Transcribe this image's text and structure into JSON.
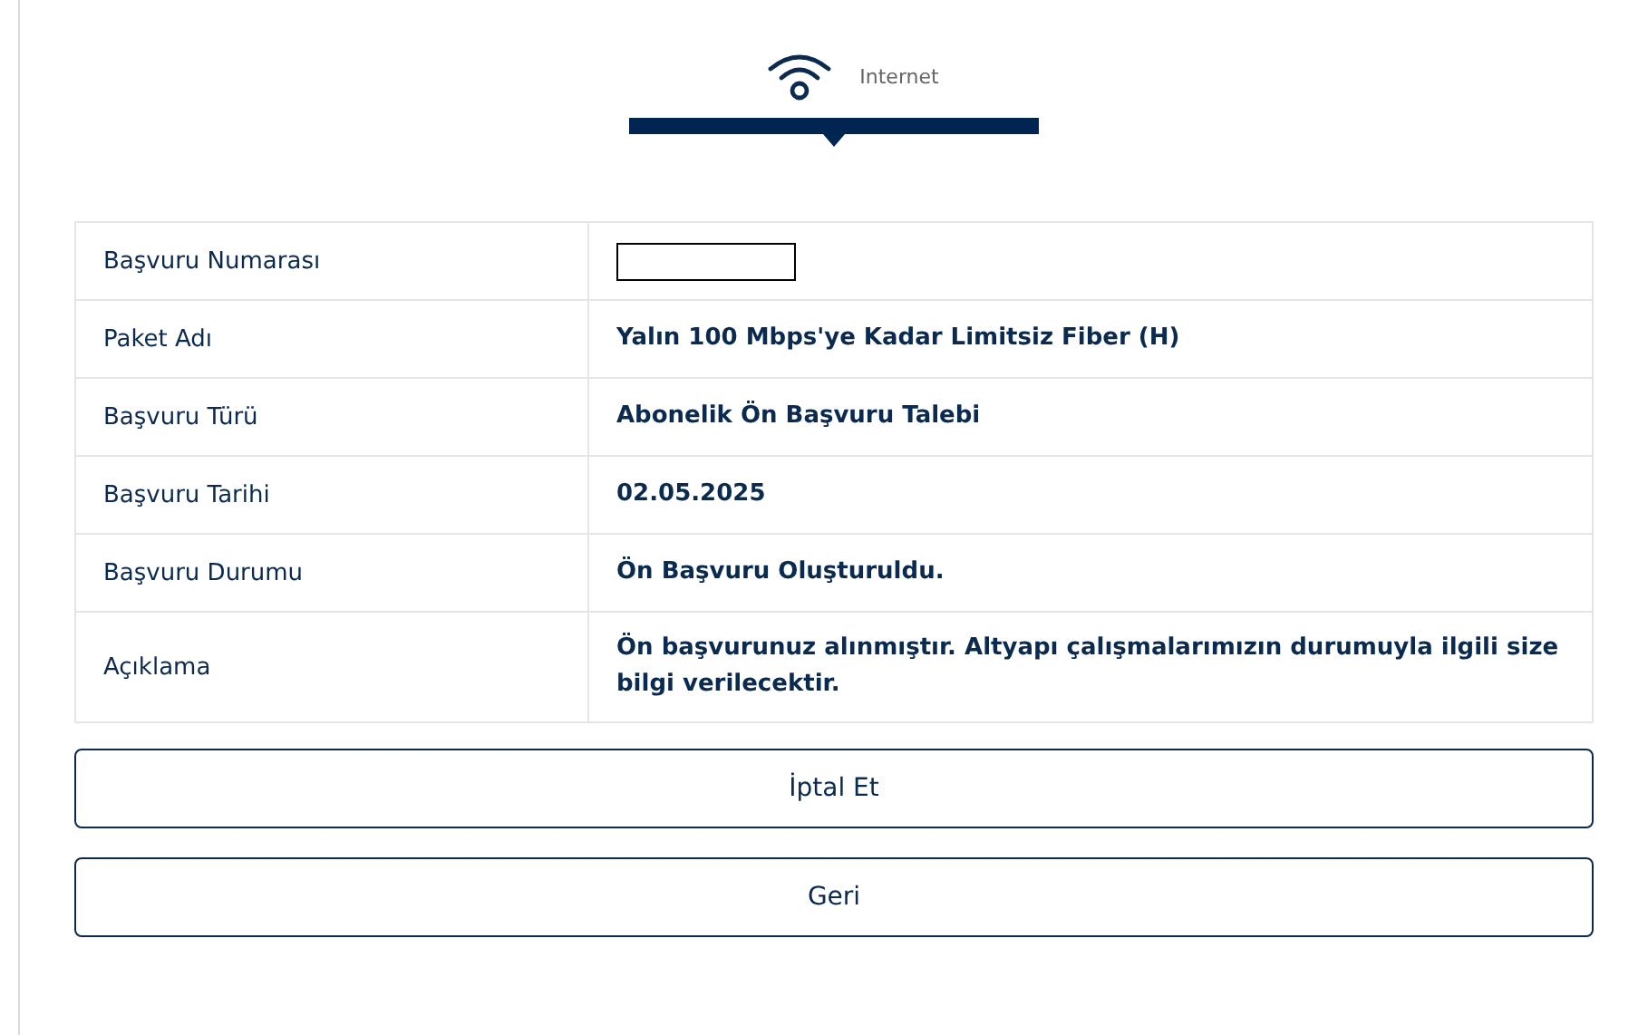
{
  "step": {
    "label": "Internet",
    "selected": true
  },
  "rows": [
    {
      "label": "Başvuru Numarası",
      "kind": "redacted"
    },
    {
      "label": "Paket Adı",
      "kind": "text",
      "value": "Yalın 100 Mbps'ye Kadar Limitsiz Fiber (H)"
    },
    {
      "label": "Başvuru Türü",
      "kind": "text",
      "value": "Abonelik Ön Başvuru Talebi"
    },
    {
      "label": "Başvuru Tarihi",
      "kind": "text",
      "value": "02.05.2025"
    },
    {
      "label": "Başvuru Durumu",
      "kind": "text",
      "value": "Ön Başvuru Oluşturuldu."
    },
    {
      "label": "Açıklama",
      "kind": "text",
      "value": "Ön başvurunuz alınmıştır. Altyapı çalışmalarımızın durumuyla ilgili size bilgi verilecektir."
    }
  ],
  "buttons": [
    "İptal Et",
    "Geri"
  ]
}
